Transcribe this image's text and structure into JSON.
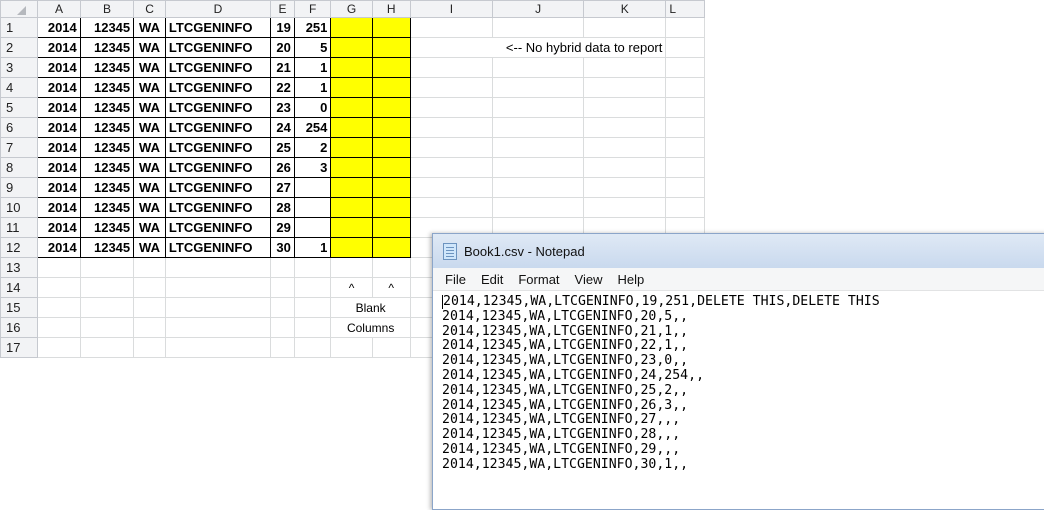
{
  "sheet": {
    "columns": [
      "A",
      "B",
      "C",
      "D",
      "E",
      "F",
      "G",
      "H",
      "I",
      "J",
      "K",
      "L"
    ],
    "rows": [
      {
        "n": "1",
        "a": "2014",
        "b": "12345",
        "c": "WA",
        "d": "LTCGENINFO",
        "e": "19",
        "f": "251"
      },
      {
        "n": "2",
        "a": "2014",
        "b": "12345",
        "c": "WA",
        "d": "LTCGENINFO",
        "e": "20",
        "f": "5"
      },
      {
        "n": "3",
        "a": "2014",
        "b": "12345",
        "c": "WA",
        "d": "LTCGENINFO",
        "e": "21",
        "f": "1"
      },
      {
        "n": "4",
        "a": "2014",
        "b": "12345",
        "c": "WA",
        "d": "LTCGENINFO",
        "e": "22",
        "f": "1"
      },
      {
        "n": "5",
        "a": "2014",
        "b": "12345",
        "c": "WA",
        "d": "LTCGENINFO",
        "e": "23",
        "f": "0"
      },
      {
        "n": "6",
        "a": "2014",
        "b": "12345",
        "c": "WA",
        "d": "LTCGENINFO",
        "e": "24",
        "f": "254"
      },
      {
        "n": "7",
        "a": "2014",
        "b": "12345",
        "c": "WA",
        "d": "LTCGENINFO",
        "e": "25",
        "f": "2"
      },
      {
        "n": "8",
        "a": "2014",
        "b": "12345",
        "c": "WA",
        "d": "LTCGENINFO",
        "e": "26",
        "f": "3"
      },
      {
        "n": "9",
        "a": "2014",
        "b": "12345",
        "c": "WA",
        "d": "LTCGENINFO",
        "e": "27",
        "f": ""
      },
      {
        "n": "10",
        "a": "2014",
        "b": "12345",
        "c": "WA",
        "d": "LTCGENINFO",
        "e": "28",
        "f": ""
      },
      {
        "n": "11",
        "a": "2014",
        "b": "12345",
        "c": "WA",
        "d": "LTCGENINFO",
        "e": "29",
        "f": ""
      },
      {
        "n": "12",
        "a": "2014",
        "b": "12345",
        "c": "WA",
        "d": "LTCGENINFO",
        "e": "30",
        "f": "1"
      }
    ],
    "empty_rows": [
      "13",
      "14",
      "15",
      "16",
      "17"
    ],
    "note": "<-- No hybrid data to report",
    "caret_marks": [
      "^",
      "^"
    ],
    "caption_line1": "Blank",
    "caption_line2": "Columns",
    "highlight_color": "#ffff00"
  },
  "notepad": {
    "title": "Book1.csv - Notepad",
    "menu": [
      "File",
      "Edit",
      "Format",
      "View",
      "Help"
    ],
    "lines": [
      "2014,12345,WA,LTCGENINFO,19,251,DELETE THIS,DELETE THIS",
      "2014,12345,WA,LTCGENINFO,20,5,,",
      "2014,12345,WA,LTCGENINFO,21,1,,",
      "2014,12345,WA,LTCGENINFO,22,1,,",
      "2014,12345,WA,LTCGENINFO,23,0,,",
      "2014,12345,WA,LTCGENINFO,24,254,,",
      "2014,12345,WA,LTCGENINFO,25,2,,",
      "2014,12345,WA,LTCGENINFO,26,3,,",
      "2014,12345,WA,LTCGENINFO,27,,,",
      "2014,12345,WA,LTCGENINFO,28,,,",
      "2014,12345,WA,LTCGENINFO,29,,,",
      "2014,12345,WA,LTCGENINFO,30,1,,"
    ]
  }
}
